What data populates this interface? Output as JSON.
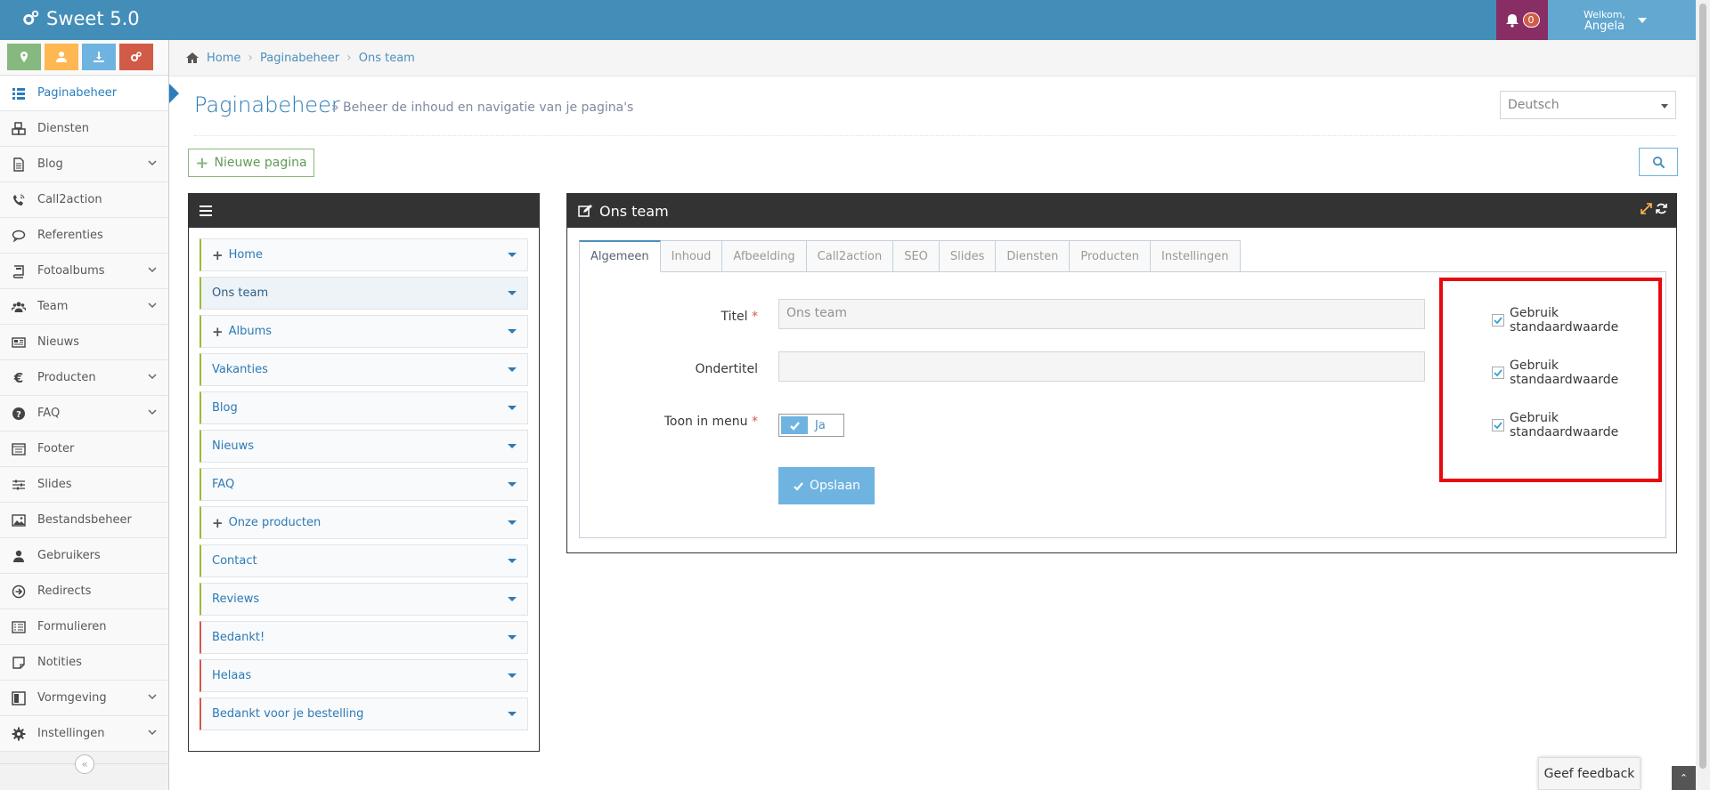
{
  "app": {
    "title": "Sweet 5.0"
  },
  "topbar": {
    "notification_count": "0",
    "welcome": "Welkom,",
    "user": "Angela"
  },
  "colors": {
    "header": "#438eb9",
    "notif": "#892e65",
    "user": "#62a8d1",
    "highlight": "#e8080f",
    "accent": "#2b7dbc"
  },
  "shortcuts": [
    {
      "icon": "map-marker-icon",
      "color": "#87b87f"
    },
    {
      "icon": "user-icon",
      "color": "#ffb752"
    },
    {
      "icon": "download-icon",
      "color": "#6fb3e0"
    },
    {
      "icon": "cogs-icon",
      "color": "#d15b47"
    }
  ],
  "sidebar": {
    "items": [
      {
        "label": "Paginabeheer",
        "icon": "list-icon",
        "active": true
      },
      {
        "label": "Diensten",
        "icon": "cubes-icon"
      },
      {
        "label": "Blog",
        "icon": "file-text-icon",
        "submenu": true
      },
      {
        "label": "Call2action",
        "icon": "phone-volume-icon"
      },
      {
        "label": "Referenties",
        "icon": "comment-icon"
      },
      {
        "label": "Fotoalbums",
        "icon": "book-icon",
        "submenu": true
      },
      {
        "label": "Team",
        "icon": "users-icon",
        "submenu": true
      },
      {
        "label": "Nieuws",
        "icon": "newspaper-icon"
      },
      {
        "label": "Producten",
        "icon": "euro-icon",
        "submenu": true
      },
      {
        "label": "FAQ",
        "icon": "question-circle-icon",
        "submenu": true
      },
      {
        "label": "Footer",
        "icon": "list-alt-icon"
      },
      {
        "label": "Slides",
        "icon": "sliders-icon"
      },
      {
        "label": "Bestandsbeheer",
        "icon": "image-icon"
      },
      {
        "label": "Gebruikers",
        "icon": "user-icon"
      },
      {
        "label": "Redirects",
        "icon": "arrow-circle-right-icon"
      },
      {
        "label": "Formulieren",
        "icon": "list-alt-icon"
      },
      {
        "label": "Notities",
        "icon": "sticky-note-icon"
      },
      {
        "label": "Vormgeving",
        "icon": "columns-icon",
        "submenu": true
      },
      {
        "label": "Instellingen",
        "icon": "gear-icon",
        "submenu": true
      }
    ]
  },
  "breadcrumb": [
    "Home",
    "Paginabeheer",
    "Ons team"
  ],
  "page": {
    "title": "Paginabeheer",
    "subtitle": "» Beheer de inhoud en navigatie van je pagina's",
    "language": "Deutsch",
    "new_page": "Nieuwe pagina"
  },
  "tree": [
    {
      "label": "Home",
      "plus": true
    },
    {
      "label": "Ons team",
      "active": true
    },
    {
      "label": "Albums",
      "plus": true
    },
    {
      "label": "Vakanties"
    },
    {
      "label": "Blog"
    },
    {
      "label": "Nieuws"
    },
    {
      "label": "FAQ"
    },
    {
      "label": "Onze producten",
      "plus": true
    },
    {
      "label": "Contact"
    },
    {
      "label": "Reviews"
    },
    {
      "label": "Bedankt!",
      "red": true
    },
    {
      "label": "Helaas",
      "red": true
    },
    {
      "label": "Bedankt voor je bestelling",
      "red": true
    }
  ],
  "editor": {
    "title": "Ons team",
    "tabs": [
      "Algemeen",
      "Inhoud",
      "Afbeelding",
      "Call2action",
      "SEO",
      "Slides",
      "Diensten",
      "Producten",
      "Instellingen"
    ],
    "active_tab": "Algemeen",
    "fields": {
      "titel_label": "Titel",
      "titel_value": "Ons team",
      "ondertitel_label": "Ondertitel",
      "ondertitel_value": "",
      "toon_label": "Toon in menu",
      "toon_value": "Ja",
      "required": "*"
    },
    "default_label": "Gebruik standaardwaarde",
    "save": "Opslaan"
  },
  "feedback": "Geef feedback",
  "collapse": "«"
}
